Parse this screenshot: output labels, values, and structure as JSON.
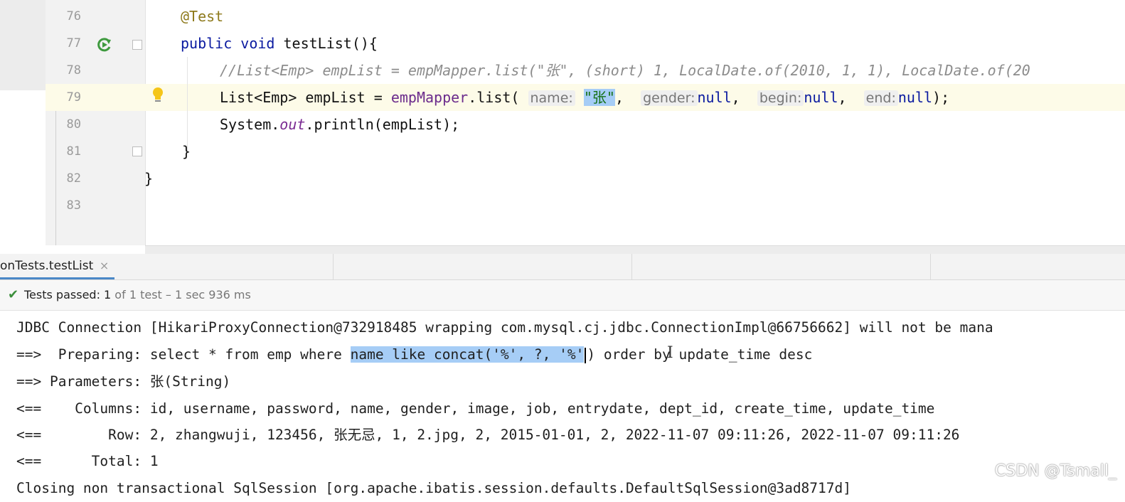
{
  "editor": {
    "line_numbers": [
      "76",
      "77",
      "78",
      "79",
      "80",
      "81",
      "82",
      "83"
    ],
    "lines": {
      "l76": "@Test",
      "l77_kw": "public void ",
      "l77_rest": "testList(){",
      "l78": "//List<Emp> empList = empMapper.list(\"张\", (short) 1, LocalDate.of(2010, 1, 1), LocalDate.of(20",
      "l79_a": "List<Emp> empList = ",
      "l79_b": "empMapper",
      "l79_c": ".list(",
      "l79_hint_name": "name:",
      "l79_str": "\"张\"",
      "l79_comma1": ",",
      "l79_hint_gender": "gender:",
      "l79_null1": "null",
      "l79_comma2": ",",
      "l79_hint_begin": "begin:",
      "l79_null2": "null",
      "l79_comma3": ",",
      "l79_hint_end": "end:",
      "l79_null3": "null",
      "l79_end": ");",
      "l80_a": "System.",
      "l80_b": "out",
      "l80_c": ".println(empList);",
      "l81": "}",
      "l82": "}"
    }
  },
  "run_tab": {
    "title": "onTests.testList",
    "close": "×"
  },
  "status": {
    "passed_label": "Tests passed: 1",
    "detail": " of 1 test – 1 sec 936 ms"
  },
  "console": {
    "line1": "JDBC Connection [HikariProxyConnection@732918485 wrapping com.mysql.cj.jdbc.ConnectionImpl@66756662] will not be mana",
    "line2_a": "==>  Preparing: select * from emp where ",
    "line2_sel": "name like concat('%', ?, '%'",
    "line2_b": ") order by update_time desc",
    "line3": "==> Parameters: 张(String)",
    "line4": "<==    Columns: id, username, password, name, gender, image, job, entrydate, dept_id, create_time, update_time",
    "line5": "<==        Row: 2, zhangwuji, 123456, 张无忌, 1, 2.jpg, 2, 2015-01-01, 2, 2022-11-07 09:11:26, 2022-11-07 09:11:26",
    "line6": "<==      Total: 1",
    "line7": "Closing non transactional SqlSession [org.apache.ibatis.session.defaults.DefaultSqlSession@3ad8717d]"
  },
  "watermark": "CSDN @Tsmall_",
  "colors": {
    "selection": "#a6cdf6",
    "passed_green": "#3c8f3c",
    "tab_underline": "#4a88c7"
  },
  "icons": [
    "run-test-icon",
    "fold-icon",
    "intention-bulb-icon",
    "check-icon",
    "close-icon",
    "text-cursor-icon"
  ]
}
